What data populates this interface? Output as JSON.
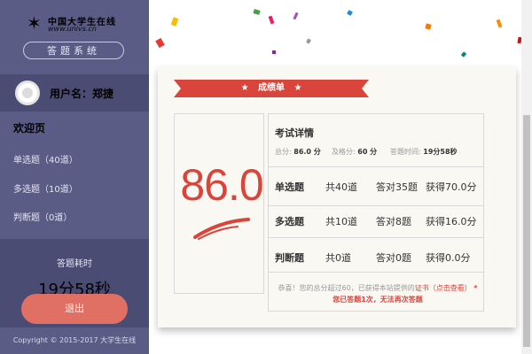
{
  "brand": {
    "name": "中国大学生在线",
    "url": "www.univs.cn",
    "logo_icon": "running-person-icon"
  },
  "sidebar": {
    "system_button": "答题系统",
    "user_label": "用户名：郑捷",
    "welcome": "欢迎页",
    "items": [
      {
        "label": "单选题（40道）"
      },
      {
        "label": "多选题（10道）"
      },
      {
        "label": "判断题（0道）"
      }
    ],
    "timer_label": "答题耗时",
    "timer_value": "19分58秒",
    "logout": "退出",
    "copyright": "Copyright © 2015-2017 大学生在线"
  },
  "result": {
    "ribbon_title": "成绩单",
    "score": "86.0",
    "detail_title": "考试详情",
    "meta": {
      "total_label": "总分:",
      "total_value": "86.0 分",
      "pass_label": "及格分:",
      "pass_value": "60 分",
      "time_label": "答题时间:",
      "time_value": "19分58秒"
    },
    "rows": [
      {
        "type": "单选题",
        "count": "共40道",
        "correct": "答对35题",
        "earned": "获得70.0分"
      },
      {
        "type": "多选题",
        "count": "共10道",
        "correct": "答对8题",
        "earned": "获得16.0分"
      },
      {
        "type": "判断题",
        "count": "共0道",
        "correct": "答对0题",
        "earned": "获得0.0分"
      }
    ],
    "note_prefix": "恭喜！您的总分超过60，已获得本站提供的",
    "note_link": "证书（点击查看）",
    "note_warn": "*您已答题1次，无法再次答题"
  },
  "colors": {
    "sidebar": "#5b5c86",
    "accent": "#d9453b",
    "logout": "#e06f64"
  }
}
